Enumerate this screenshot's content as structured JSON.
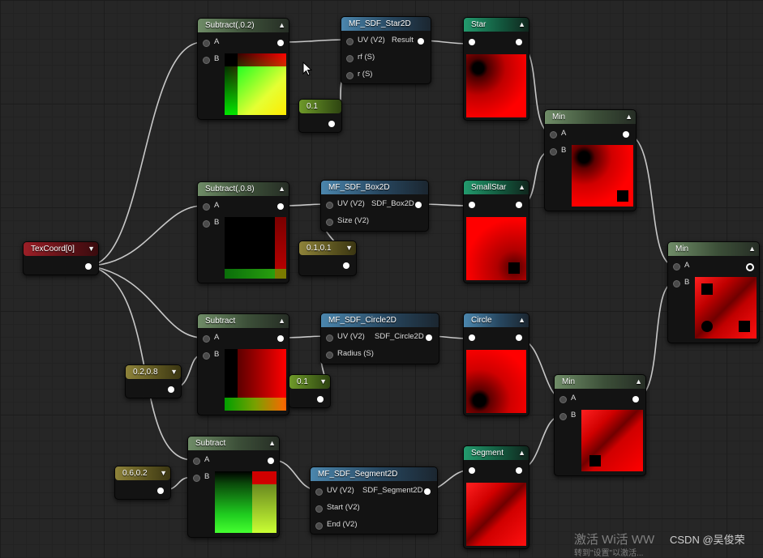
{
  "nodes": {
    "texcoord": {
      "title": "TexCoord[0]"
    },
    "sub1": {
      "title": "Subtract(,0.2)",
      "pin_a": "A",
      "pin_b": "B"
    },
    "sub2": {
      "title": "Subtract(,0.8)",
      "pin_a": "A",
      "pin_b": "B"
    },
    "sub3": {
      "title": "Subtract",
      "pin_a": "A",
      "pin_b": "B"
    },
    "sub4": {
      "title": "Subtract",
      "pin_a": "A",
      "pin_b": "B"
    },
    "star_fn": {
      "title": "MF_SDF_Star2D",
      "in1": "UV (V2)",
      "out": "Result",
      "in2": "rf (S)",
      "in3": "r (S)"
    },
    "box_fn": {
      "title": "MF_SDF_Box2D",
      "in1": "UV (V2)",
      "out": "SDF_Box2D",
      "in2": "Size (V2)"
    },
    "circle_fn": {
      "title": "MF_SDF_Circle2D",
      "in1": "UV (V2)",
      "out": "SDF_Circle2D",
      "in2": "Radius (S)"
    },
    "segment_fn": {
      "title": "MF_SDF_Segment2D",
      "in1": "UV (V2)",
      "out": "SDF_Segment2D",
      "in2": "Start (V2)",
      "in3": "End (V2)"
    },
    "const_star": {
      "title": "0.1"
    },
    "const_box": {
      "title": "0.1,0.1"
    },
    "const_circle": {
      "title": "0.1"
    },
    "const_c1": {
      "title": "0.2,0.8"
    },
    "const_c2": {
      "title": "0.6,0.2"
    },
    "star": {
      "title": "Star"
    },
    "smallstar": {
      "title": "SmallStar"
    },
    "circle": {
      "title": "Circle"
    },
    "segment": {
      "title": "Segment"
    },
    "min1": {
      "title": "Min",
      "pin_a": "A",
      "pin_b": "B"
    },
    "min2": {
      "title": "Min",
      "pin_a": "A",
      "pin_b": "B"
    },
    "min3": {
      "title": "Min",
      "pin_a": "A",
      "pin_b": "B"
    }
  },
  "watermark": {
    "text": "激活 Wi活 WW",
    "text2": "转到\"设置\"以激活..."
  },
  "credit": "CSDN @吴俊荣",
  "colors": {
    "wire": "#c8c8c8",
    "accent_red": "#d40000",
    "graph_bg": "#262626"
  }
}
